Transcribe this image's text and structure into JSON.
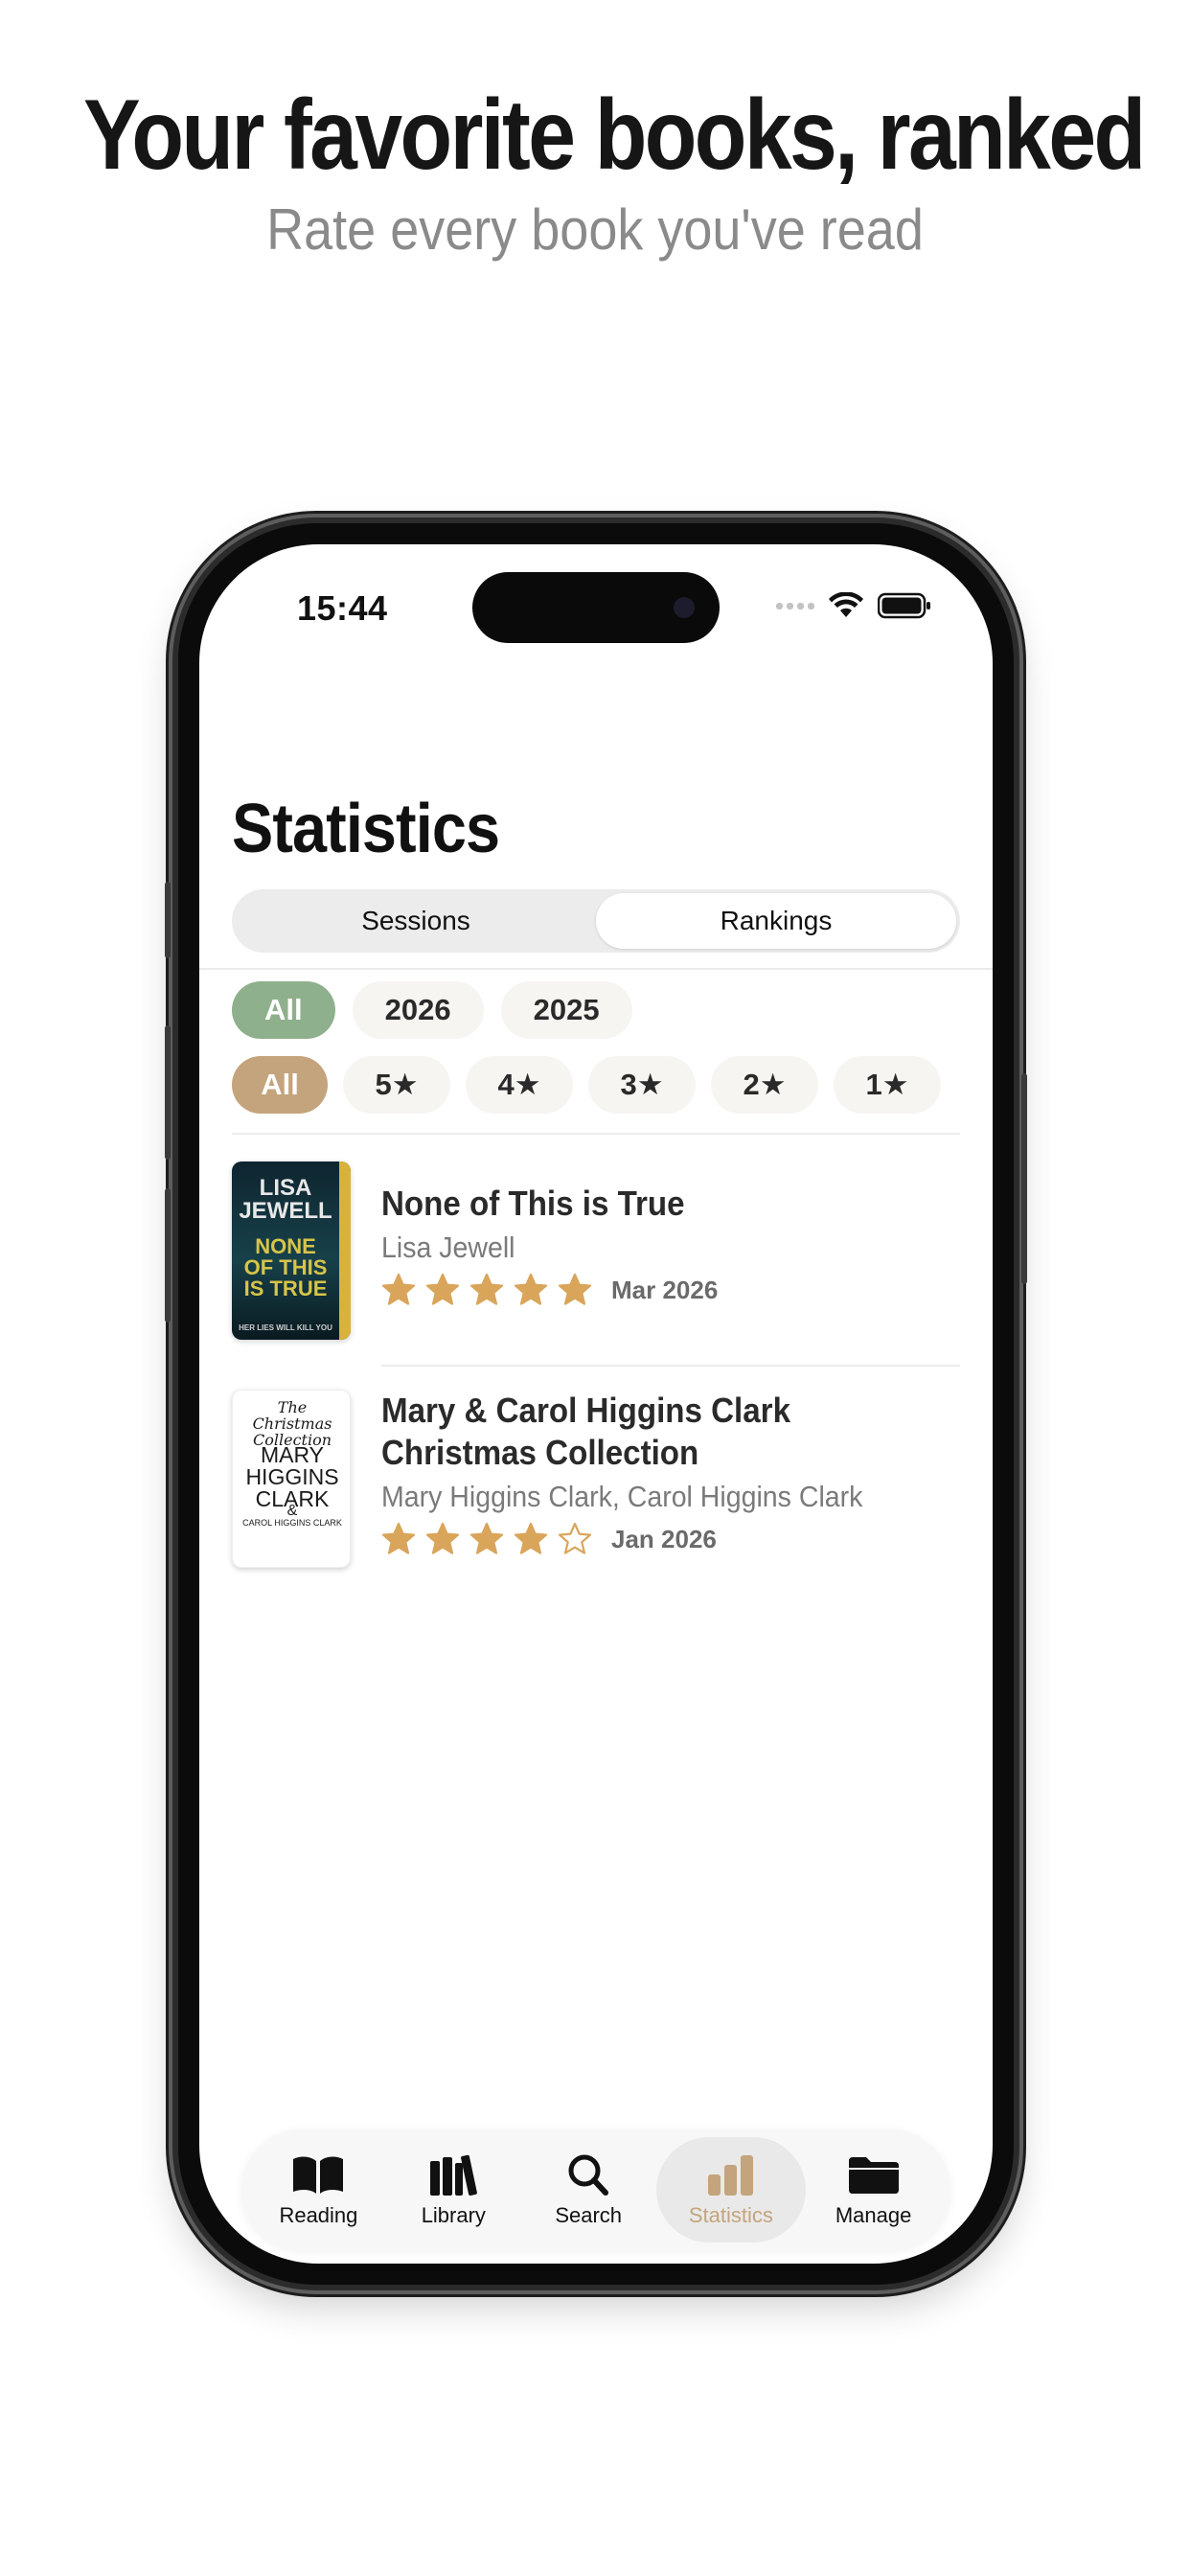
{
  "promo": {
    "headline": "Your favorite books, ranked",
    "subhead": "Rate every book you've read"
  },
  "status_bar": {
    "time": "15:44"
  },
  "screen": {
    "title": "Statistics",
    "segments": [
      "Sessions",
      "Rankings"
    ],
    "selected_segment": "Rankings"
  },
  "year_filters": {
    "items": [
      "All",
      "2026",
      "2025"
    ],
    "selected": "All"
  },
  "rating_filters": {
    "items": [
      "All",
      "5★",
      "4★",
      "3★",
      "2★",
      "1★"
    ],
    "selected": "All"
  },
  "books": [
    {
      "title_lines": [
        "None of This is True"
      ],
      "author": "Lisa Jewell",
      "rating": 5,
      "max_rating": 5,
      "date": "Mar 2026",
      "cover": {
        "author_text": "LISA JEWELL",
        "title_text": "NONE OF THIS IS TRUE",
        "tagline": "HER LIES WILL KILL YOU"
      }
    },
    {
      "title_lines": [
        "Mary & Carol Higgins Clark",
        "Christmas Collection"
      ],
      "author": "Mary Higgins Clark, Carol Higgins Clark",
      "rating": 4,
      "max_rating": 5,
      "date": "Jan 2026",
      "cover": {
        "series_text": "The Christmas Collection",
        "author_main": "MARY HIGGINS CLARK",
        "amp": "&",
        "author_second": "CAROL HIGGINS CLARK"
      }
    }
  ],
  "tabbar": {
    "items": [
      {
        "label": "Reading",
        "icon": "open-book-icon"
      },
      {
        "label": "Library",
        "icon": "books-shelf-icon"
      },
      {
        "label": "Search",
        "icon": "magnifier-icon"
      },
      {
        "label": "Statistics",
        "icon": "bar-chart-icon"
      },
      {
        "label": "Manage",
        "icon": "folder-icon"
      }
    ],
    "selected": "Statistics"
  },
  "colors": {
    "accent_green": "#8fb08c",
    "accent_tan": "#c4a47c",
    "star": "#d9a55a"
  }
}
